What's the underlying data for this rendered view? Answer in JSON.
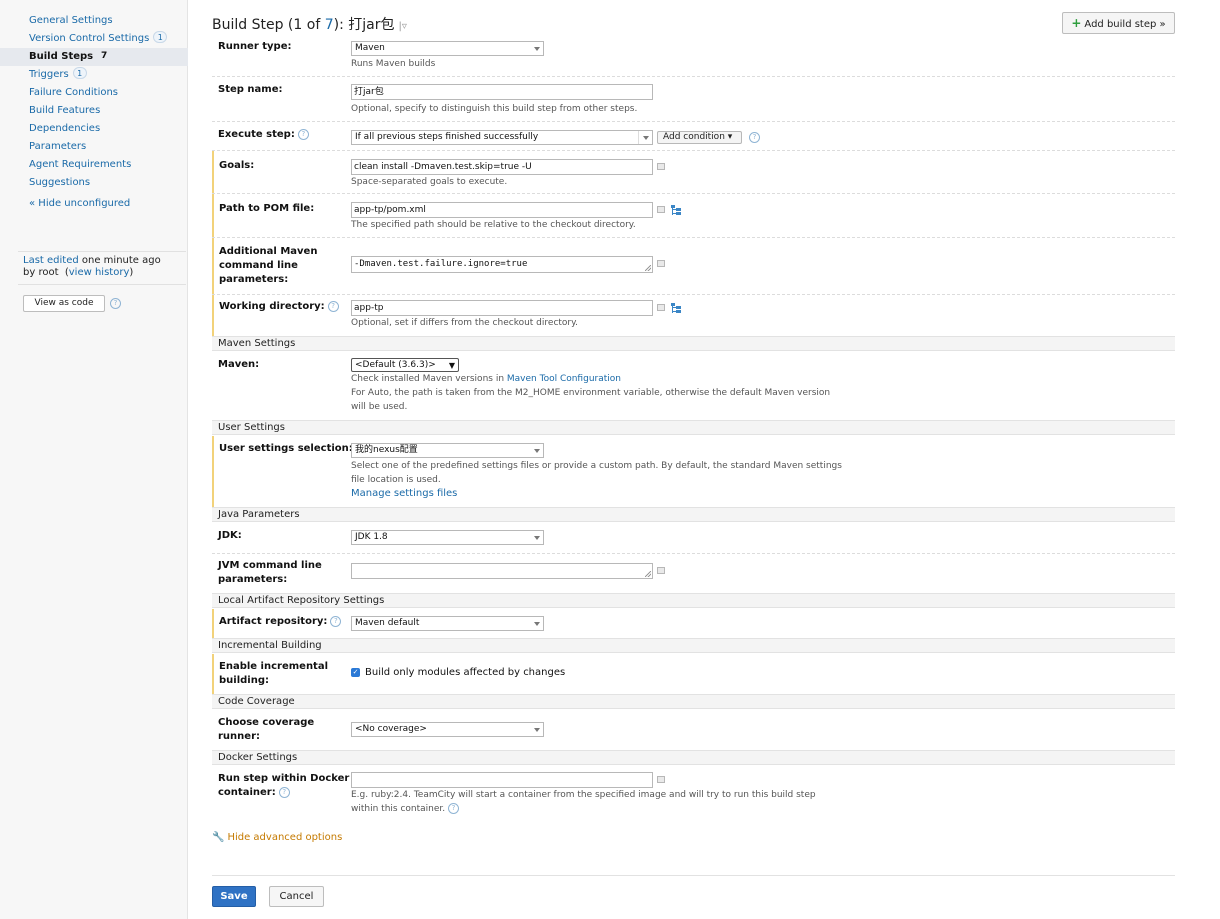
{
  "sidebar": {
    "items": [
      {
        "label": "General Settings",
        "badge": ""
      },
      {
        "label": "Version Control Settings",
        "badge": "1"
      },
      {
        "label": "Build Steps",
        "badge": "7"
      },
      {
        "label": "Triggers",
        "badge": "1"
      },
      {
        "label": "Failure Conditions",
        "badge": ""
      },
      {
        "label": "Build Features",
        "badge": ""
      },
      {
        "label": "Dependencies",
        "badge": ""
      },
      {
        "label": "Parameters",
        "badge": ""
      },
      {
        "label": "Agent Requirements",
        "badge": ""
      },
      {
        "label": "Suggestions",
        "badge": ""
      }
    ],
    "active_index": 2,
    "hide_unconfigured": "« Hide unconfigured",
    "last_edited_label": "Last edited",
    "last_edited_time": " one minute ago",
    "by_user": "by root",
    "view_history": "view history",
    "view_as_code": "View as code"
  },
  "header": {
    "title_prefix": "Build Step (",
    "step_num": "1",
    "of_text": " of ",
    "step_total": "7",
    "title_suffix": "): 打jar包",
    "add_build_step": "Add build step »"
  },
  "form": {
    "runner_type": {
      "label": "Runner type:",
      "value": "Maven",
      "hint": "Runs Maven builds"
    },
    "step_name": {
      "label": "Step name:",
      "value": "打jar包",
      "hint": "Optional, specify to distinguish this build step from other steps."
    },
    "execute_step": {
      "label": "Execute step:",
      "value": "If all previous steps finished successfully",
      "add_condition": "Add condition"
    },
    "goals": {
      "label": "Goals:",
      "value": "clean install -Dmaven.test.skip=true -U",
      "hint": "Space-separated goals to execute."
    },
    "pom": {
      "label": "Path to POM file:",
      "value": "app-tp/pom.xml",
      "hint": "The specified path should be relative to the checkout directory."
    },
    "additional": {
      "label_1": "Additional Maven",
      "label_2": "command line",
      "label_3": "parameters:",
      "value": "-Dmaven.test.failure.ignore=true"
    },
    "working_dir": {
      "label": "Working directory:",
      "value": "app-tp",
      "hint": "Optional, set if differs from the checkout directory."
    },
    "maven_settings_section": "Maven Settings",
    "maven": {
      "label": "Maven:",
      "value": "<Default (3.6.3)>",
      "hint_prefix": "Check installed Maven versions in ",
      "hint_link": "Maven Tool Configuration",
      "hint_2": "For Auto, the path is taken from the M2_HOME environment variable, otherwise the default Maven version",
      "hint_3": "will be used."
    },
    "user_settings_section": "User Settings",
    "user_settings": {
      "label": "User settings selection:",
      "value": "我的nexus配置",
      "hint_1": "Select one of the predefined settings files or provide a custom path. By default, the standard Maven settings",
      "hint_2": "file location is used.",
      "manage_link": "Manage settings files"
    },
    "java_section": "Java Parameters",
    "jdk": {
      "label": "JDK:",
      "value": "JDK 1.8"
    },
    "jvm": {
      "label_1": "JVM command line",
      "label_2": "parameters:",
      "value": ""
    },
    "local_repo_section": "Local Artifact Repository Settings",
    "artifact_repo": {
      "label": "Artifact repository:",
      "value": "Maven default"
    },
    "incremental_section": "Incremental Building",
    "incremental": {
      "label_1": "Enable incremental",
      "label_2": "building:",
      "checkbox_label": "Build only modules affected by changes",
      "checked": true
    },
    "coverage_section": "Code Coverage",
    "coverage": {
      "label_1": "Choose coverage",
      "label_2": "runner:",
      "value": "<No coverage>"
    },
    "docker_section": "Docker Settings",
    "docker": {
      "label_1": "Run step within Docker",
      "label_2": "container:",
      "value": "",
      "hint_1": "E.g. ruby:2.4. TeamCity will start a container from the specified image and will try to run this build step",
      "hint_2": "within this container."
    }
  },
  "footer": {
    "hide_advanced": "Hide advanced options",
    "save": "Save",
    "cancel": "Cancel"
  },
  "colors": {
    "link": "#1a6aa8",
    "modified_bar": "#f2d27a",
    "save_button": "#2f72c4",
    "advanced_link": "#c57a00"
  }
}
